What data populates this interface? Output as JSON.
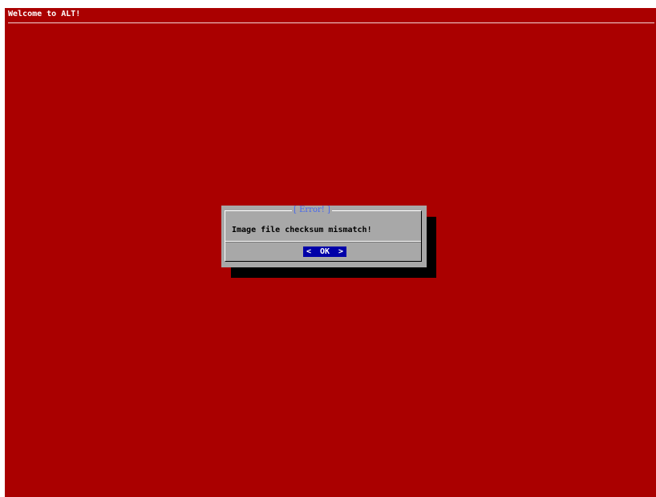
{
  "screen": {
    "title": "Welcome to ALT!",
    "background_color": "#aa0000"
  },
  "dialog": {
    "title": "[ Error! ]",
    "message": "Image file checksum mismatch!",
    "button": {
      "left_bracket": "<",
      "label": "OK",
      "right_bracket": ">"
    },
    "background_color": "#a8a8a8",
    "title_color": "#4466ee",
    "button_color": "#0000a8"
  }
}
